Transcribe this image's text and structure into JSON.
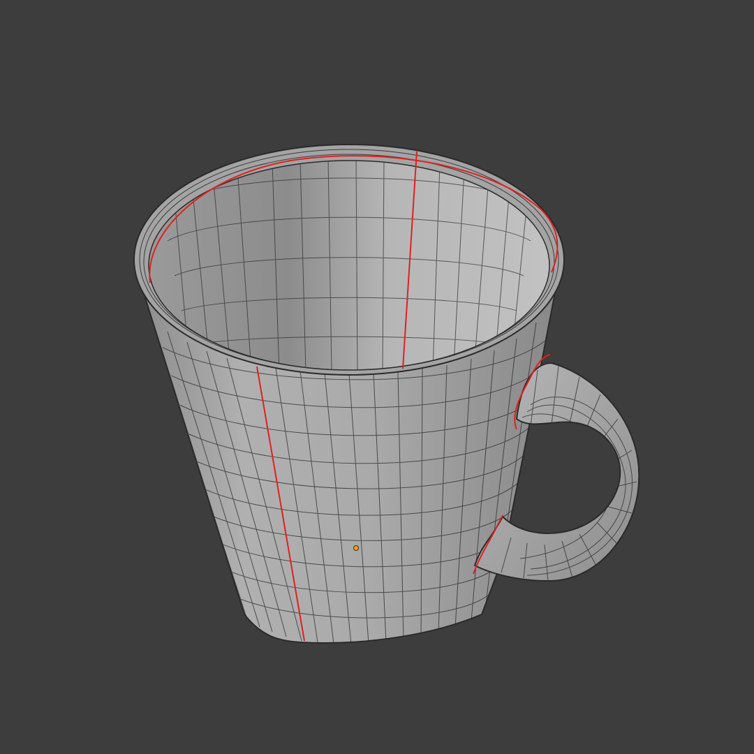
{
  "viewport": {
    "background": "#3d3d3d"
  },
  "object": {
    "kind": "mug-mesh",
    "colors": {
      "surface": "#a9a9a9",
      "surface_dark": "#8a8a8a",
      "interior": "#b3b3b3",
      "wire": "#2a2a2a",
      "seam": "#e02020",
      "origin": "#f0a020"
    }
  }
}
